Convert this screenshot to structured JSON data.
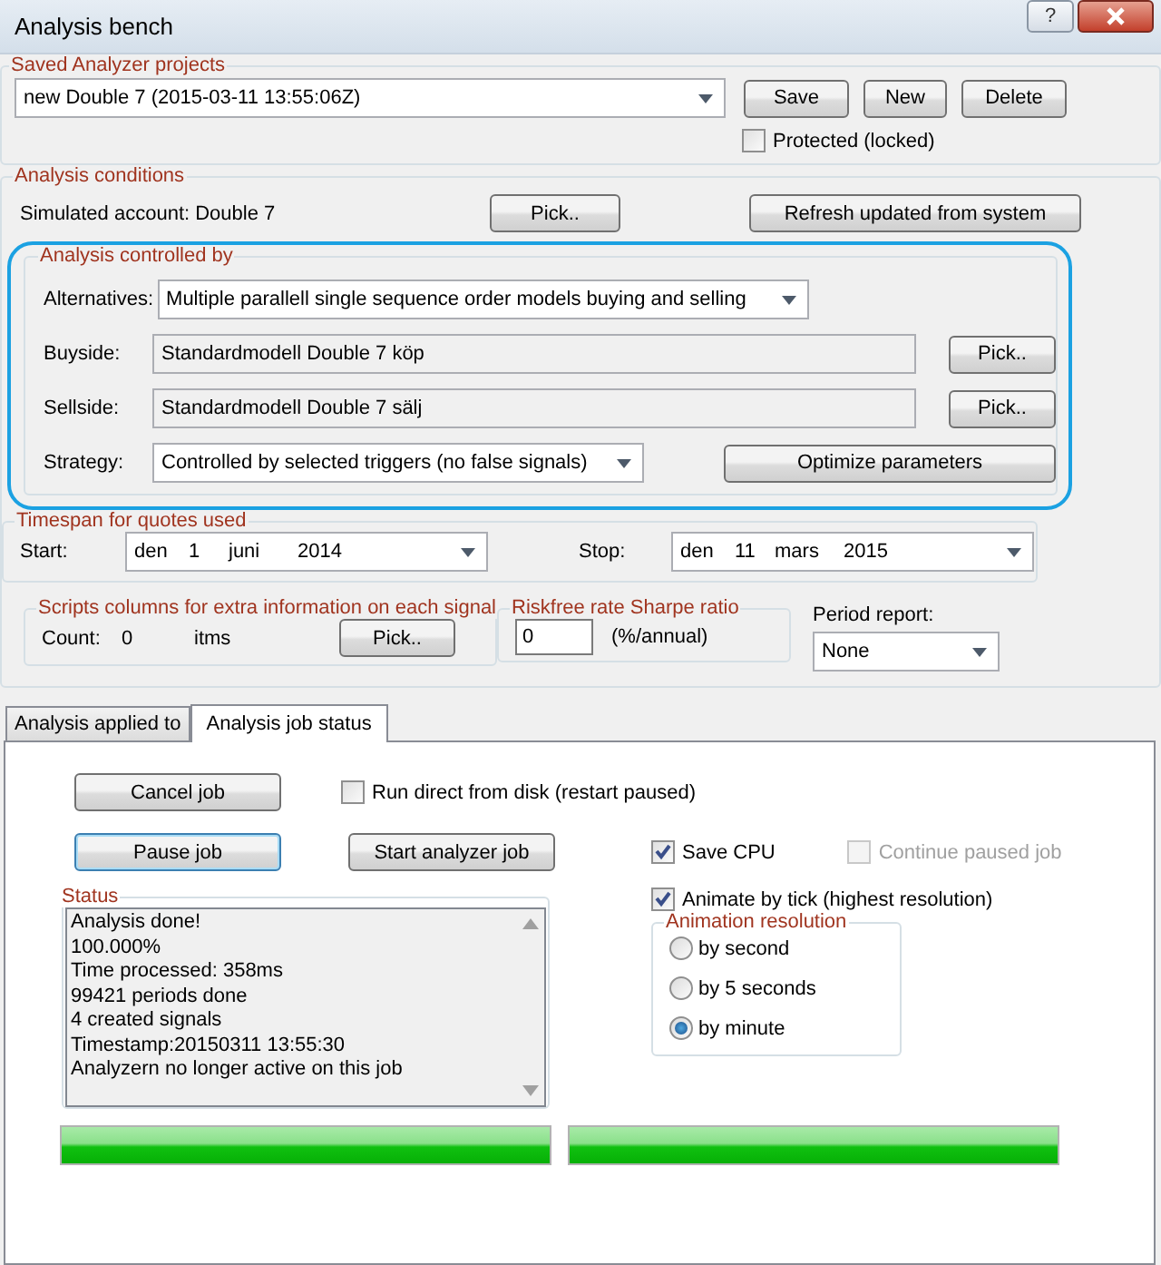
{
  "window": {
    "title": "Analysis bench",
    "help_button": "?"
  },
  "saved_projects": {
    "title": "Saved Analyzer projects",
    "project": "new Double 7  (2015-03-11 13:55:06Z)",
    "buttons": [
      "Save",
      "New",
      "Delete"
    ],
    "protected": {
      "label": "Protected (locked)",
      "checked": false
    }
  },
  "analysis_conditions": {
    "title": "Analysis conditions",
    "simulated_account": "Simulated account:  Double 7",
    "pick_button": "Pick..",
    "refresh_button": "Refresh updated from system",
    "controlled_by": {
      "title": "Analysis controlled by",
      "alternatives_label": "Alternatives:",
      "alternatives": "Multiple parallell single sequence order models buying and selling",
      "buyside_label": "Buyside:",
      "buyside": "Standardmodell Double 7 köp",
      "buyside_pick": "Pick..",
      "sellside_label": "Sellside:",
      "sellside": "Standardmodell Double 7 sälj",
      "sellside_pick": "Pick..",
      "strategy_label": "Strategy:",
      "strategy": "Controlled by selected triggers (no false signals)",
      "optimize_button": "Optimize parameters"
    },
    "timespan": {
      "title": "Timespan for quotes used",
      "start_label": "Start:",
      "start": [
        "den",
        "1",
        "juni",
        "2014"
      ],
      "stop_label": "Stop:",
      "stop": [
        "den",
        "11",
        "mars",
        "2015"
      ]
    },
    "scripts": {
      "title": "Scripts columns for extra information on each signal",
      "count_label": "Count:",
      "count": "0",
      "unit": "itms",
      "pick_button": "Pick.."
    },
    "riskfree": {
      "title": "Riskfree rate Sharpe ratio",
      "value": "0",
      "unit": "(%/annual)"
    },
    "period_report": {
      "label": "Period report:",
      "value": "None"
    }
  },
  "tabs": [
    {
      "label": "Analysis applied to",
      "selected": false
    },
    {
      "label": "Analysis job status",
      "selected": true
    }
  ],
  "job": {
    "cancel_button": "Cancel job",
    "run_from_disk": {
      "label": "Run direct from disk (restart paused)",
      "checked": false,
      "disabled": false
    },
    "pause_button": {
      "label": "Pause job",
      "focused": true
    },
    "start_button": "Start analyzer job",
    "save_cpu": {
      "label": "Save CPU",
      "checked": true,
      "disabled": false
    },
    "continue_paused": {
      "label": "Continue paused job",
      "checked": false,
      "disabled": true
    },
    "status": {
      "title": "Status",
      "lines": [
        "Analysis done!",
        "100.000%",
        "Time processed: 358ms",
        "99421 periods done",
        "4 created signals",
        "Timestamp:20150311 13:55:30",
        "Analyzern no longer active on this job"
      ]
    },
    "animate_by_tick": {
      "label": "Animate by tick (highest resolution)",
      "checked": true,
      "disabled": false
    },
    "animation_resolution": {
      "title": "Animation resolution",
      "options": [
        {
          "label": "by second",
          "selected": false
        },
        {
          "label": "by 5 seconds",
          "selected": false
        },
        {
          "label": "by minute",
          "selected": true
        }
      ]
    },
    "progress": [
      {
        "level": 1
      },
      {
        "level": 1
      }
    ]
  }
}
